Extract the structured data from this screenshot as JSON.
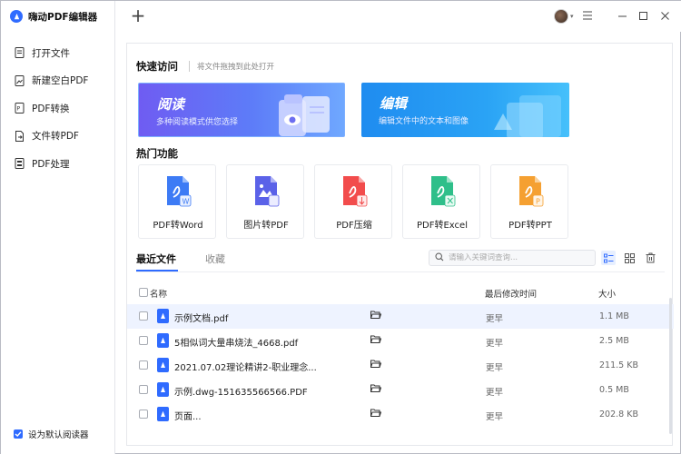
{
  "app": {
    "title": "嗨动PDF编辑器"
  },
  "sidebar": {
    "items": [
      {
        "label": "打开文件",
        "icon": "file-icon"
      },
      {
        "label": "新建空白PDF",
        "icon": "image-file-icon"
      },
      {
        "label": "PDF转换",
        "icon": "convert-icon"
      },
      {
        "label": "文件转PDF",
        "icon": "file-to-pdf-icon"
      },
      {
        "label": "PDF处理",
        "icon": "process-icon"
      }
    ],
    "default_reader_label": "设为默认阅读器",
    "default_reader_checked": true
  },
  "titlebar": {
    "new_tab_symbol": "+"
  },
  "quick_access": {
    "heading": "快速访问",
    "hint": "将文件拖拽到此处打开",
    "cards": [
      {
        "title": "阅读",
        "subtitle": "多种阅读模式供您选择"
      },
      {
        "title": "编辑",
        "subtitle": "编辑文件中的文本和图像"
      }
    ]
  },
  "hot_features": {
    "heading": "热门功能",
    "tools": [
      {
        "label": "PDF转Word",
        "color": "#3d7bf5"
      },
      {
        "label": "图片转PDF",
        "color": "#5b62e8"
      },
      {
        "label": "PDF压缩",
        "color": "#f24c4c"
      },
      {
        "label": "PDF转Excel",
        "color": "#2fbf8a"
      },
      {
        "label": "PDF转PPT",
        "color": "#f5a031"
      }
    ]
  },
  "recent": {
    "tabs": [
      "最近文件",
      "收藏"
    ],
    "search_placeholder": "请输入关键词查询...",
    "columns": {
      "name": "名称",
      "modified": "最后修改时间",
      "size": "大小"
    },
    "rows": [
      {
        "name": "示例文档.pdf",
        "modified": "更早",
        "size": "1.1 MB"
      },
      {
        "name": "5相似词大量串烧法_4668.pdf",
        "modified": "更早",
        "size": "2.5 MB"
      },
      {
        "name": "2021.07.02理论精讲2-职业理念...",
        "modified": "更早",
        "size": "211.5 KB"
      },
      {
        "name": "示例.dwg-1516355665​66.PDF",
        "modified": "更早",
        "size": "0.5 MB"
      },
      {
        "name": "页面...",
        "modified": "更早",
        "size": "202.8 KB"
      }
    ]
  },
  "colors": {
    "accent": "#2f6bff"
  }
}
